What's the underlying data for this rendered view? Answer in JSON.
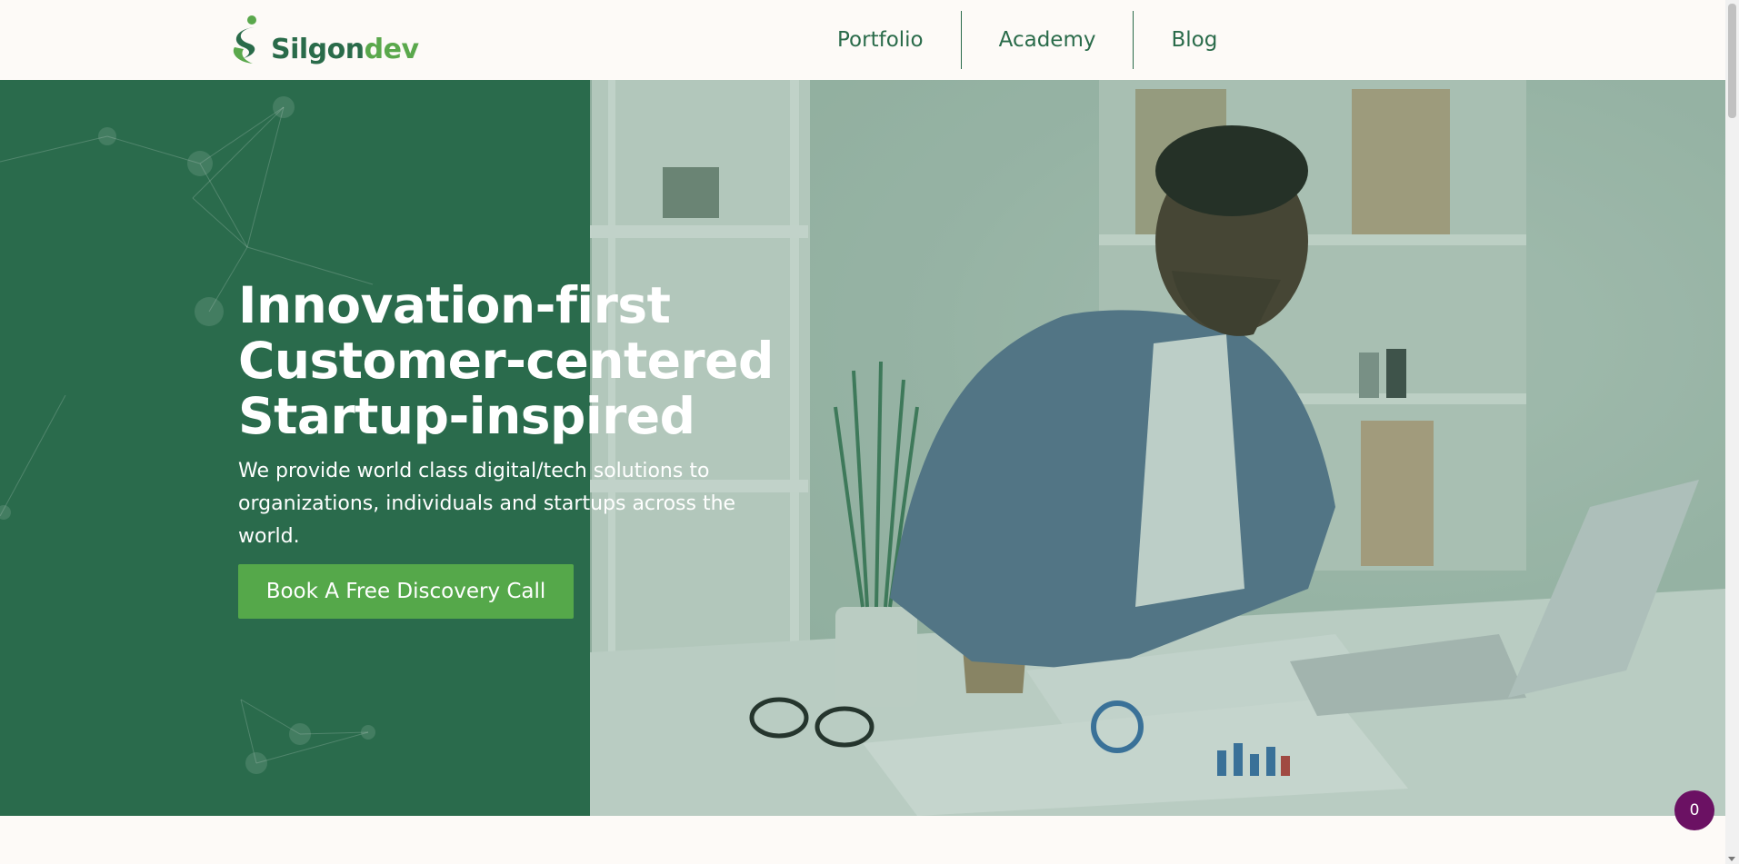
{
  "header": {
    "logo": {
      "part1": "Silgon",
      "part2": "dev"
    },
    "nav": [
      {
        "label": "Portfolio"
      },
      {
        "label": "Academy"
      },
      {
        "label": "Blog"
      }
    ]
  },
  "hero": {
    "title_lines": [
      "Innovation-first",
      "Customer-centered",
      "Startup-inspired"
    ],
    "subtitle": "We provide world class digital/tech solutions to organizations, individuals and startups across the world.",
    "cta_label": "Book A Free Discovery Call",
    "image_icon": "office-photo-icon"
  },
  "badge": {
    "count": "0"
  },
  "colors": {
    "brand_dark": "#2a6b4a",
    "brand_light": "#5aa84c",
    "hero_panel": "#2a6b4c",
    "cta": "#55a84a",
    "badge": "#6b1163"
  }
}
